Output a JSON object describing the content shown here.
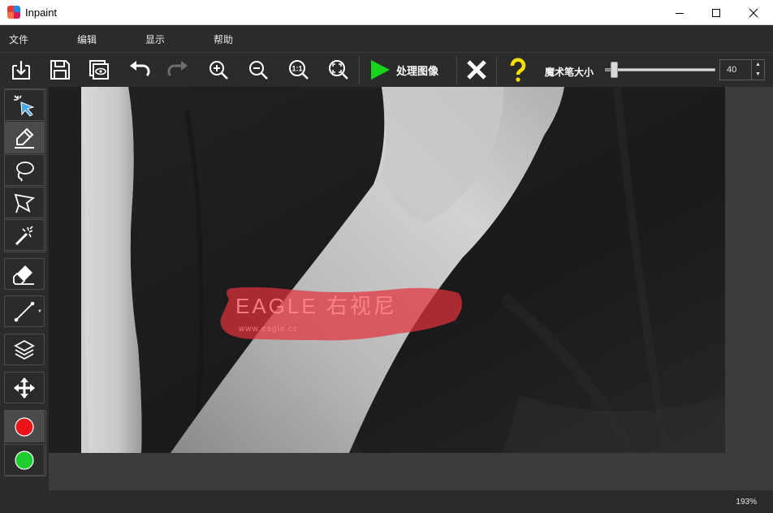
{
  "window": {
    "title": "Inpaint",
    "icons": {
      "app": "app-icon",
      "minimize": "minimize-icon",
      "maximize": "maximize-icon",
      "close": "close-icon"
    }
  },
  "menu": {
    "file": "文件",
    "edit": "编辑",
    "view": "显示",
    "help": "帮助"
  },
  "toolbar": {
    "items": [
      "open-icon",
      "save-icon",
      "batch-view-icon",
      "undo-icon",
      "redo-icon",
      "zoom-in-icon",
      "zoom-out-icon",
      "actual-size-icon",
      "fit-window-icon"
    ],
    "actual_size_glyph": "1:1",
    "process_label": "处理图像",
    "cancel": "cancel-x-icon",
    "help": "help-question-icon",
    "brush_size_label": "魔术笔大小",
    "brush_size_value": "40",
    "brush_size_slider_level": 0.05
  },
  "tools": {
    "items": [
      "smart-select-icon",
      "marker-icon",
      "lasso-icon",
      "polygon-lasso-icon",
      "magic-wand-icon",
      "eraser-icon",
      "guide-line-icon",
      "layers-icon",
      "move-icon",
      "red-mark-icon",
      "green-mark-icon"
    ],
    "active": "marker-icon",
    "colors": {
      "red": "#e8141a",
      "green": "#1fcc2e",
      "mask": "#e2323c"
    }
  },
  "canvas": {
    "watermark_text": "EAGLE 右视尼",
    "watermark_url": "www.eagle.cc"
  },
  "status": {
    "zoom": "193%"
  }
}
